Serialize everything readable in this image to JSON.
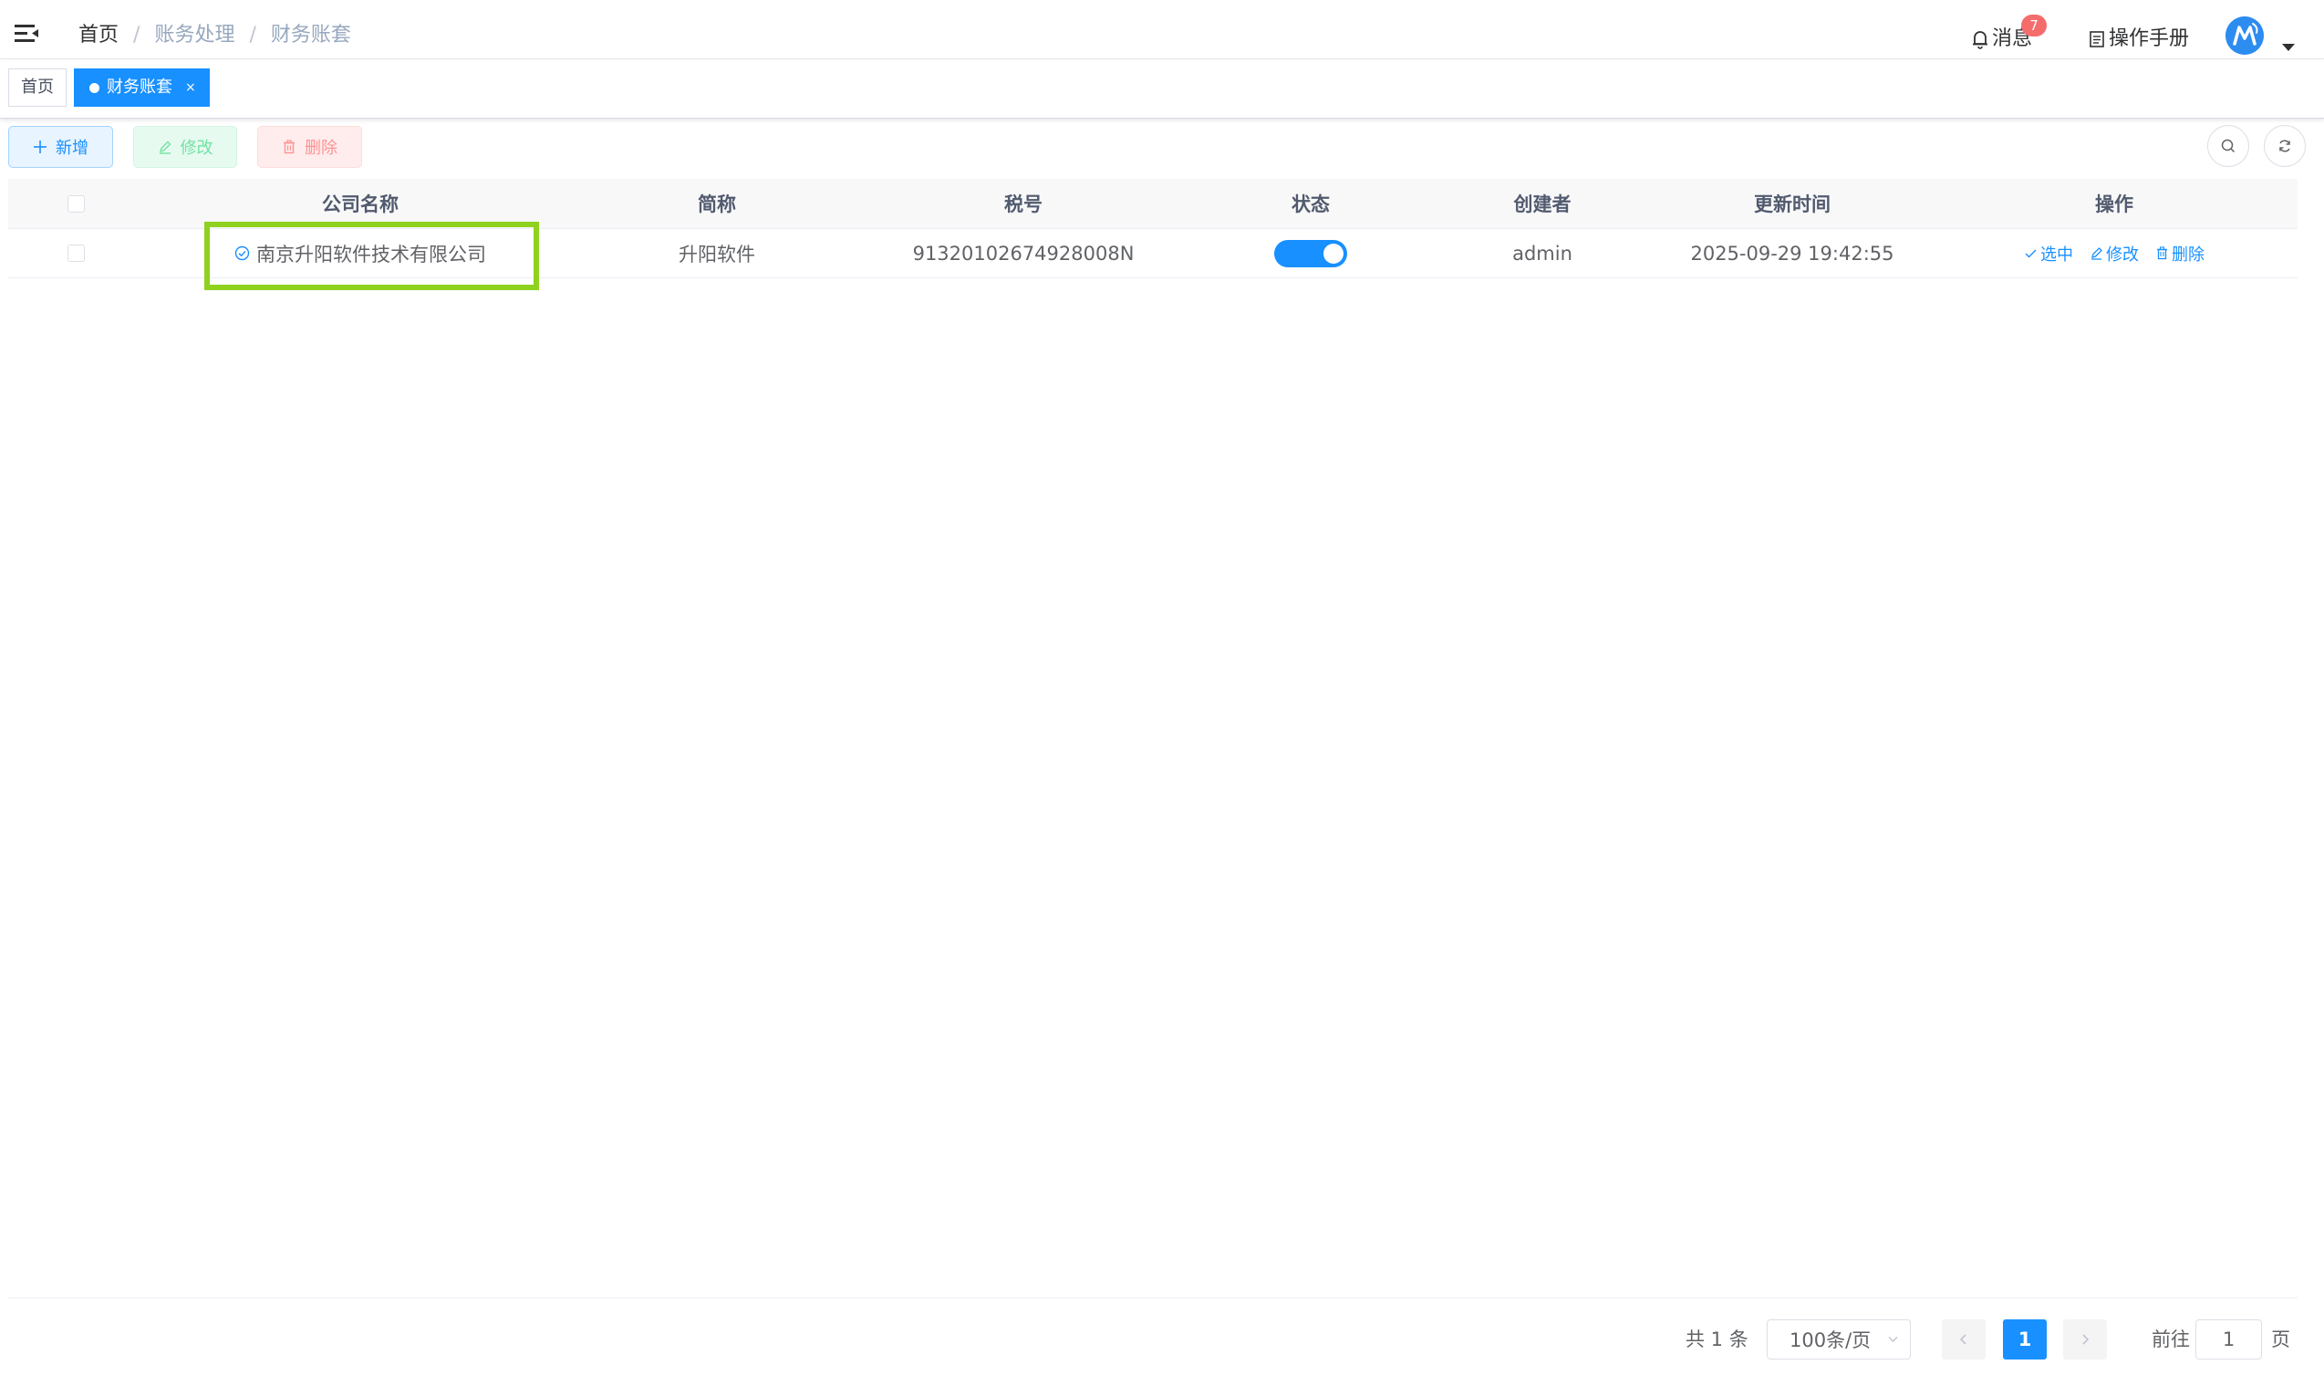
{
  "breadcrumb": [
    "首页",
    "账务处理",
    "财务账套"
  ],
  "navbar": {
    "messages_label": "消息",
    "messages_badge": "7",
    "manual_label": "操作手册",
    "avatar_letter": "M"
  },
  "tags": {
    "home": "首页",
    "active": "财务账套",
    "close": "×"
  },
  "toolbar": {
    "add": "新增",
    "edit": "修改",
    "delete": "删除"
  },
  "table": {
    "columns": [
      "公司名称",
      "简称",
      "税号",
      "状态",
      "创建者",
      "更新时间",
      "操作"
    ],
    "rows": [
      {
        "company_name": "南京升阳软件技术有限公司",
        "abbreviation": "升阳软件",
        "tax_id": "91320102674928008N",
        "status_enabled": true,
        "creator": "admin",
        "updated_at": "2025-09-29 19:42:55",
        "actions": [
          "选中",
          "修改",
          "删除"
        ]
      }
    ]
  },
  "pagination": {
    "total_text": "共 1 条",
    "page_size": "100条/页",
    "current_page": "1",
    "goto_label": "前往",
    "goto_value": "1",
    "page_suffix": "页"
  },
  "colors": {
    "primary": "#1890ff",
    "highlight": "#8fd11f",
    "danger": "#f56c6c",
    "success": "#71e2a3"
  }
}
